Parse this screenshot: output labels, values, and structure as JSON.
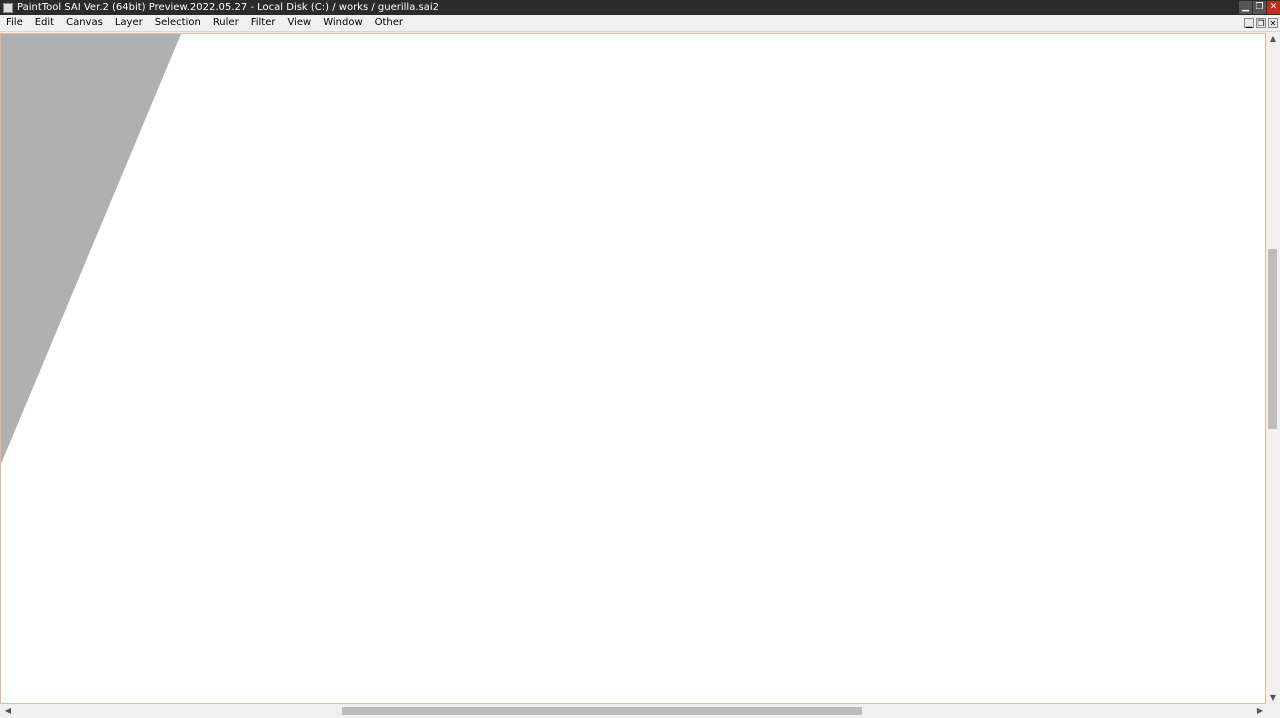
{
  "titlebar": {
    "title": "PaintTool SAI Ver.2 (64bit) Preview.2022.05.27 - Local Disk (C:) / works / guerilla.sai2",
    "minimize": "▁",
    "maximize": "❐",
    "close": "✕"
  },
  "menubar": {
    "items": [
      {
        "label": "File"
      },
      {
        "label": "Edit"
      },
      {
        "label": "Canvas"
      },
      {
        "label": "Layer"
      },
      {
        "label": "Selection"
      },
      {
        "label": "Ruler"
      },
      {
        "label": "Filter"
      },
      {
        "label": "View"
      },
      {
        "label": "Window"
      },
      {
        "label": "Other"
      }
    ],
    "mdi_minimize": "▁",
    "mdi_restore": "❐",
    "mdi_close": "✕"
  },
  "canvas": {
    "background": "#ffffff",
    "offcanvas_color": "#b0b0b0",
    "border_color": "#e8b890"
  },
  "scrollbars": {
    "up": "▲",
    "down": "▼",
    "left": "◀",
    "right": "▶"
  }
}
